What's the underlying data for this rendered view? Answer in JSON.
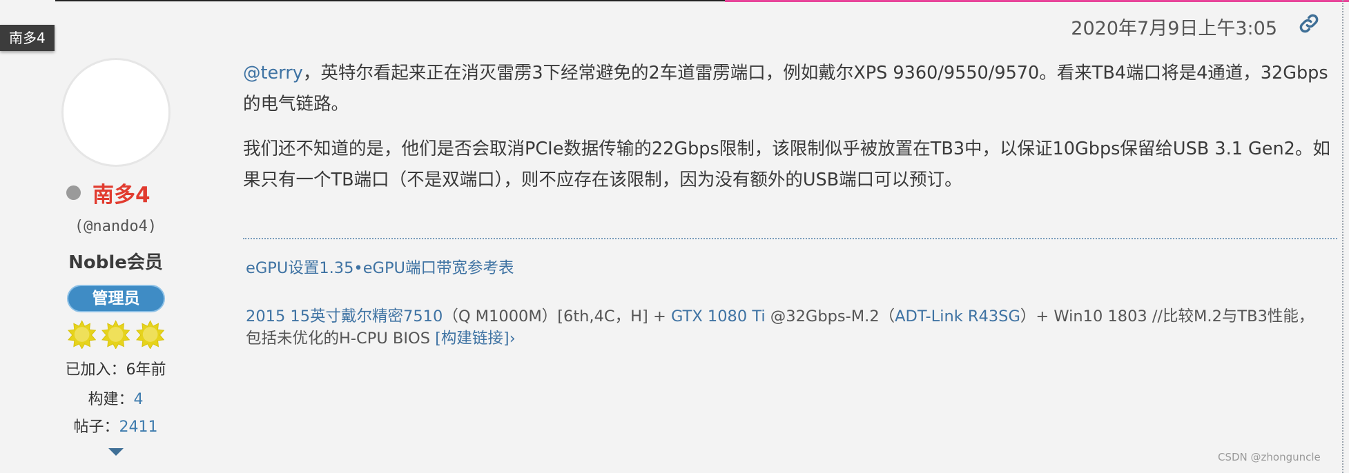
{
  "theme": {
    "accent": "#3f73a3",
    "username_color": "#e13b2f",
    "badge_color": "#3f8cc5",
    "top_bar_pink": "#e8459a"
  },
  "user": {
    "tag": "南多4",
    "name": "南多4",
    "handle": "(@nando4)",
    "rank": "Noble会员",
    "role": "管理员",
    "star_count": 3,
    "joined_label": "已加入：",
    "joined_value": "6年前",
    "builds_label": "构建：",
    "builds_value": "4",
    "posts_label": "帖子：",
    "posts_value": "2411",
    "status_icon": "offline-dot-icon",
    "more_icon": "chevron-down-icon"
  },
  "post": {
    "timestamp": "2020年7月9日上午3:05",
    "permalink_icon": "link-icon",
    "mention": "@terry",
    "p1_text": "，英特尔看起来正在消灭雷雳3下经常避免的2车道雷雳端口，例如戴尔XPS 9360/9550/9570。看来TB4端口将是4通道，32Gbps的电气链路。",
    "p2_text": "我们还不知道的是，他们是否会取消PCIe数据传输的22Gbps限制，该限制似乎被放置在TB3中，以保证10Gbps保留给USB 3.1 Gen2。如果只有一个TB端口（不是双端口），则不应存在该限制，因为没有额外的USB端口可以预订。"
  },
  "signature": {
    "link1": "eGPU设置1.35",
    "separator": "•",
    "link2": "eGPU端口带宽参考表",
    "laptop_link": "2015 15英寸戴尔精密7510",
    "laptop_spec": "（Q M1000M）[6th,4C，H] + ",
    "gpu_link": "GTX 1080 Ti",
    "gpu_spec": " @32Gbps-M.2（",
    "adapter_link": "ADT-Link R43SG",
    "rest": "）+ Win10 1803 //比较M.2与TB3性能，包括未优化的H-CPU BIOS ",
    "build_link": "[构建链接]",
    "arrow": "›"
  },
  "watermark": "CSDN @zhonguncle"
}
